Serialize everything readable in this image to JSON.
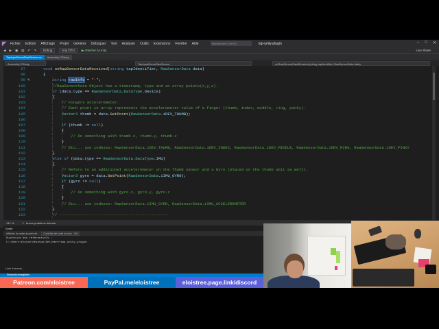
{
  "app": {
    "menu": [
      "Fichier",
      "Edition",
      "Affichage",
      "Projet",
      "Générer",
      "Déboguer",
      "Test",
      "Analyser",
      "Outils",
      "Extensions",
      "Fenêtre",
      "Aide"
    ],
    "search_placeholder": "Rechercher (Ctrl+Q)",
    "project_name": "tap-unity-plugin"
  },
  "toolbar": {
    "config": "Debug",
    "platform": "Any CPU",
    "attach": "Attacher à Unity",
    "live_share": "Live Share"
  },
  "tabs": {
    "active": "TapInputDemoRawSensor.cs",
    "inactive": "Assembly-CSharp"
  },
  "navbar": {
    "project": "Assembly-CSharp",
    "class": "TapInputDemoRawSensor",
    "method": "onRawSensorDataReceived(string tapIdentifier, RawSensorData data)"
  },
  "code_lines": [
    {
      "n": "97",
      "ind": 1,
      "parts": [
        [
          "kw",
          "void "
        ],
        [
          "fn",
          "onRawSensorDataReceived"
        ],
        [
          "",
          "("
        ],
        [
          "kw",
          "string "
        ],
        [
          "vr",
          "tapIdentifier"
        ],
        [
          "",
          ", "
        ],
        [
          "ty",
          "RawSensorData "
        ],
        [
          "vr",
          "data"
        ],
        [
          "",
          ")"
        ]
      ]
    },
    {
      "n": "98",
      "ind": 1,
      "parts": [
        [
          "",
          "{"
        ]
      ]
    },
    {
      "n": "99",
      "ind": 2,
      "parts": [
        [
          "kw",
          "string "
        ],
        [
          "hl",
          "rawInfo"
        ],
        [
          "",
          " = "
        ],
        [
          "st",
          "\"-\""
        ],
        [
          "",
          ";"
        ]
      ],
      "edit": true
    },
    {
      "n": "100",
      "ind": 2,
      "parts": [
        [
          "cm",
          "//RawSensorData Object has a timestamp, type and an array points(x,y,z)."
        ]
      ]
    },
    {
      "n": "101",
      "ind": 2,
      "parts": [
        [
          "kw",
          "if "
        ],
        [
          "",
          "("
        ],
        [
          "vr",
          "data"
        ],
        [
          "",
          "."
        ],
        [
          "vr",
          "type"
        ],
        [
          "",
          " == "
        ],
        [
          "ty",
          "RawSensorData"
        ],
        [
          "",
          "."
        ],
        [
          "ty",
          "DataType"
        ],
        [
          "",
          "."
        ],
        [
          "vr",
          "Device"
        ],
        [
          "",
          ")"
        ]
      ]
    },
    {
      "n": "102",
      "ind": 2,
      "parts": [
        [
          "",
          "{"
        ]
      ]
    },
    {
      "n": "103",
      "ind": 3,
      "parts": [
        [
          "cm",
          "// Fingers accelerometer."
        ]
      ]
    },
    {
      "n": "104",
      "ind": 3,
      "parts": [
        [
          "cm",
          "// Each point in array represents the accelerometer value of a finger (thumb, index, middle, ring, pinky)."
        ]
      ]
    },
    {
      "n": "105",
      "ind": 3,
      "parts": [
        [
          "ty",
          "Vector3 "
        ],
        [
          "vr",
          "thumb"
        ],
        [
          "",
          " = "
        ],
        [
          "vr",
          "data"
        ],
        [
          "",
          "."
        ],
        [
          "fn",
          "GetPoint"
        ],
        [
          "",
          "("
        ],
        [
          "ty",
          "RawSensorData"
        ],
        [
          "",
          "."
        ],
        [
          "vr",
          "iDEV_THUMB"
        ],
        [
          "",
          ");"
        ]
      ]
    },
    {
      "n": "106",
      "ind": 3,
      "parts": []
    },
    {
      "n": "107",
      "ind": 3,
      "parts": [
        [
          "kw",
          "if "
        ],
        [
          "",
          "("
        ],
        [
          "vr",
          "thumb"
        ],
        [
          "",
          " != "
        ],
        [
          "kw",
          "null"
        ],
        [
          "",
          ")"
        ]
      ]
    },
    {
      "n": "108",
      "ind": 3,
      "parts": [
        [
          "",
          "{"
        ]
      ]
    },
    {
      "n": "109",
      "ind": 4,
      "parts": [
        [
          "cm",
          "// Do something with thumb.x, thumb.y, thumb.z"
        ]
      ]
    },
    {
      "n": "110",
      "ind": 3,
      "parts": [
        [
          "",
          "}"
        ]
      ]
    },
    {
      "n": "111",
      "ind": 3,
      "parts": [
        [
          "cm",
          "// Etc... use indexes: RawSensorData.iDEV_THUMB, RawSensorData.iDEV_INDEX, RawSensorData.iDEV_MIDDLE, RawSensorData.iDEV_RING, RawSensorData.iDEV_PINKY"
        ]
      ]
    },
    {
      "n": "112",
      "ind": 2,
      "parts": [
        [
          "",
          "}"
        ]
      ]
    },
    {
      "n": "113",
      "ind": 2,
      "parts": [
        [
          "kw",
          "else if "
        ],
        [
          "",
          "("
        ],
        [
          "vr",
          "data"
        ],
        [
          "",
          "."
        ],
        [
          "vr",
          "type"
        ],
        [
          "",
          " == "
        ],
        [
          "ty",
          "RawSensorData"
        ],
        [
          "",
          "."
        ],
        [
          "ty",
          "DataType"
        ],
        [
          "",
          "."
        ],
        [
          "vr",
          "IMU"
        ],
        [
          "",
          ")"
        ]
      ]
    },
    {
      "n": "114",
      "ind": 2,
      "parts": [
        [
          "",
          "{"
        ]
      ]
    },
    {
      "n": "115",
      "ind": 3,
      "parts": [
        [
          "cm",
          "// Refers to an additional accelerometer on the Thumb sensor and a Gyro (placed on the thumb unit as well)."
        ]
      ]
    },
    {
      "n": "116",
      "ind": 3,
      "parts": [
        [
          "ty",
          "Vector3 "
        ],
        [
          "vr",
          "gyro"
        ],
        [
          "",
          " = "
        ],
        [
          "vr",
          "data"
        ],
        [
          "",
          "."
        ],
        [
          "fn",
          "GetPoint"
        ],
        [
          "",
          "("
        ],
        [
          "ty",
          "RawSensorData"
        ],
        [
          "",
          "."
        ],
        [
          "vr",
          "iIMU_GYRO"
        ],
        [
          "",
          ");"
        ]
      ]
    },
    {
      "n": "117",
      "ind": 3,
      "parts": [
        [
          "kw",
          "if "
        ],
        [
          "",
          "("
        ],
        [
          "vr",
          "gyro"
        ],
        [
          "",
          " != "
        ],
        [
          "kw",
          "null"
        ],
        [
          "",
          ")"
        ]
      ]
    },
    {
      "n": "118",
      "ind": 3,
      "parts": [
        [
          "",
          "{"
        ]
      ]
    },
    {
      "n": "119",
      "ind": 4,
      "parts": [
        [
          "cm",
          "// Do something with gyro.x, gyro.y, gyro.z"
        ]
      ]
    },
    {
      "n": "120",
      "ind": 3,
      "parts": [
        [
          "",
          "}"
        ]
      ]
    },
    {
      "n": "121",
      "ind": 3,
      "parts": [
        [
          "cm",
          "// Etc... use indexes: RawSensorData.iIMU_GYRO, RawSensorData.iIMU_ACCELEROMETER"
        ]
      ]
    },
    {
      "n": "122",
      "ind": 2,
      "parts": [
        [
          "",
          "}"
        ]
      ]
    },
    {
      "n": "123",
      "ind": 2,
      "parts": [
        [
          "cm",
          "// -----------------------------------------------"
        ]
      ]
    }
  ],
  "editor_status": {
    "zoom": "141 %",
    "issues": "Aucun problème détecté"
  },
  "output": {
    "tab": "Sortie",
    "show_from_label": "Afficher la sortie à partir de :",
    "source": "Contrôle de code source - Git",
    "lines": [
      "Ouverture des référentiels :",
      "C:\\Users\\eloise\\Desktop\\Deliebre\\tap-unity-plugin"
    ],
    "side_label": "Liste d'erreurs ..."
  },
  "statusbar": {
    "text": "Éléments enregistrés"
  },
  "banners": {
    "patreon": "Patreon.com/eloistree",
    "paypal": "PayPal.me/eloistree",
    "page": "eloistree.page.link/discord"
  },
  "colors": {
    "accent": "#007acc",
    "patreon": "#f96854",
    "paypal": "#0070ba",
    "page": "#5b5fd9"
  }
}
